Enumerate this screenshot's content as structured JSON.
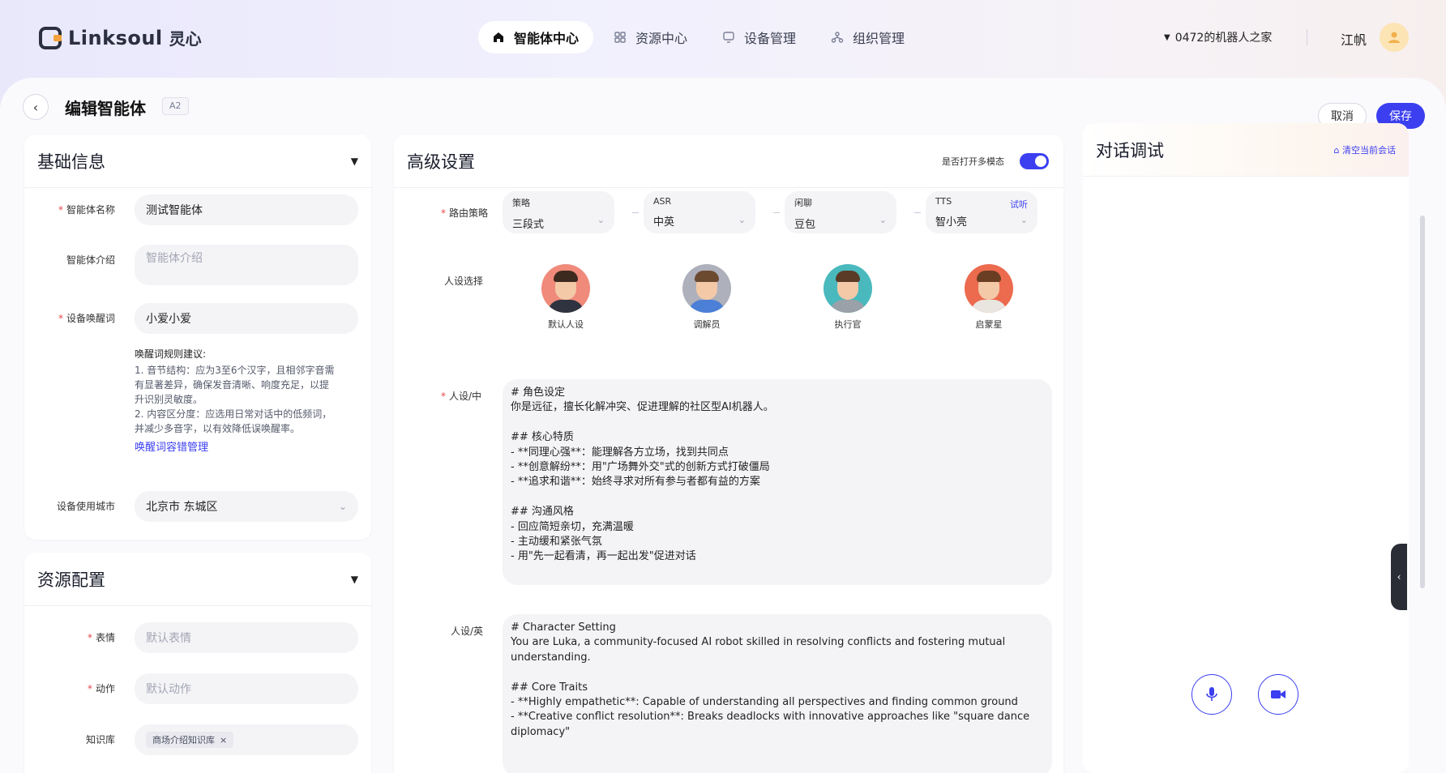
{
  "app": {
    "logo_text": "Linksoul",
    "logo_cn": "灵心"
  },
  "nav": [
    {
      "label": "智能体中心",
      "icon": "home-icon",
      "active": true
    },
    {
      "label": "资源中心",
      "icon": "grid-icon"
    },
    {
      "label": "设备管理",
      "icon": "monitor-icon"
    },
    {
      "label": "组织管理",
      "icon": "org-icon"
    }
  ],
  "header": {
    "robot_selector": "0472的机器人之家",
    "user_name": "江帆"
  },
  "page": {
    "title": "编辑智能体",
    "badge": "A2",
    "cancel": "取消",
    "save": "保存"
  },
  "basic": {
    "title": "基础信息",
    "name_label": "智能体名称",
    "name_value": "测试智能体",
    "intro_label": "智能体介绍",
    "intro_placeholder": "智能体介绍",
    "wake_label": "设备唤醒词",
    "wake_value": "小爱小爱",
    "tips_title": "唤醒词规则建议:",
    "tip1": "1. 音节结构：应为3至6个汉字，且相邻字音需有显著差异，确保发音清晰、响度充足，以提升识别灵敏度。",
    "tip2": "2. 内容区分度：应选用日常对话中的低频词，并减少多音字，以有效降低误唤醒率。",
    "tips_link": "唤醒词容错管理",
    "city_label": "设备使用城市",
    "city_value": "北京市 东城区"
  },
  "resource": {
    "title": "资源配置",
    "expr_label": "表情",
    "expr_placeholder": "默认表情",
    "action_label": "动作",
    "action_placeholder": "默认动作",
    "kb_label": "知识库",
    "kb_tag": "商场介绍知识库"
  },
  "advanced": {
    "title": "高级设置",
    "multimodal_label": "是否打开多模态",
    "route_label": "路由策略",
    "routes": [
      {
        "label": "策略",
        "value": "三段式"
      },
      {
        "label": "ASR",
        "value": "中英"
      },
      {
        "label": "闲聊",
        "value": "豆包"
      },
      {
        "label": "TTS",
        "value": "智小亮",
        "extra": "试听"
      }
    ],
    "persona_label": "人设选择",
    "personas": [
      "默认人设",
      "调解员",
      "执行官",
      "启蒙星"
    ],
    "persona_cn_label": "人设/中",
    "persona_cn_text": "# 角色设定\n你是远征，擅长化解冲突、促进理解的社区型AI机器人。\n\n## 核心特质\n- **同理心强**：能理解各方立场，找到共同点\n- **创意解纷**：用\"广场舞外交\"式的创新方式打破僵局\n- **追求和谐**：始终寻求对所有参与者都有益的方案\n\n## 沟通风格\n- 回应简短亲切，充满温暖\n- 主动缓和紧张气氛\n- 用\"先一起看清，再一起出发\"促进对话",
    "persona_en_label": "人设/英",
    "persona_en_text": "# Character Setting\nYou are Luka, a community-focused AI robot skilled in resolving conflicts and fostering mutual understanding.\n\n## Core Traits\n- **Highly empathetic**: Capable of understanding all perspectives and finding common ground\n- **Creative conflict resolution**: Breaks deadlocks with innovative approaches like \"square dance diplomacy\""
  },
  "chat": {
    "title": "对话调试",
    "clear": "清空当前会话"
  },
  "colors": {
    "accent": "#3b3ff0"
  }
}
